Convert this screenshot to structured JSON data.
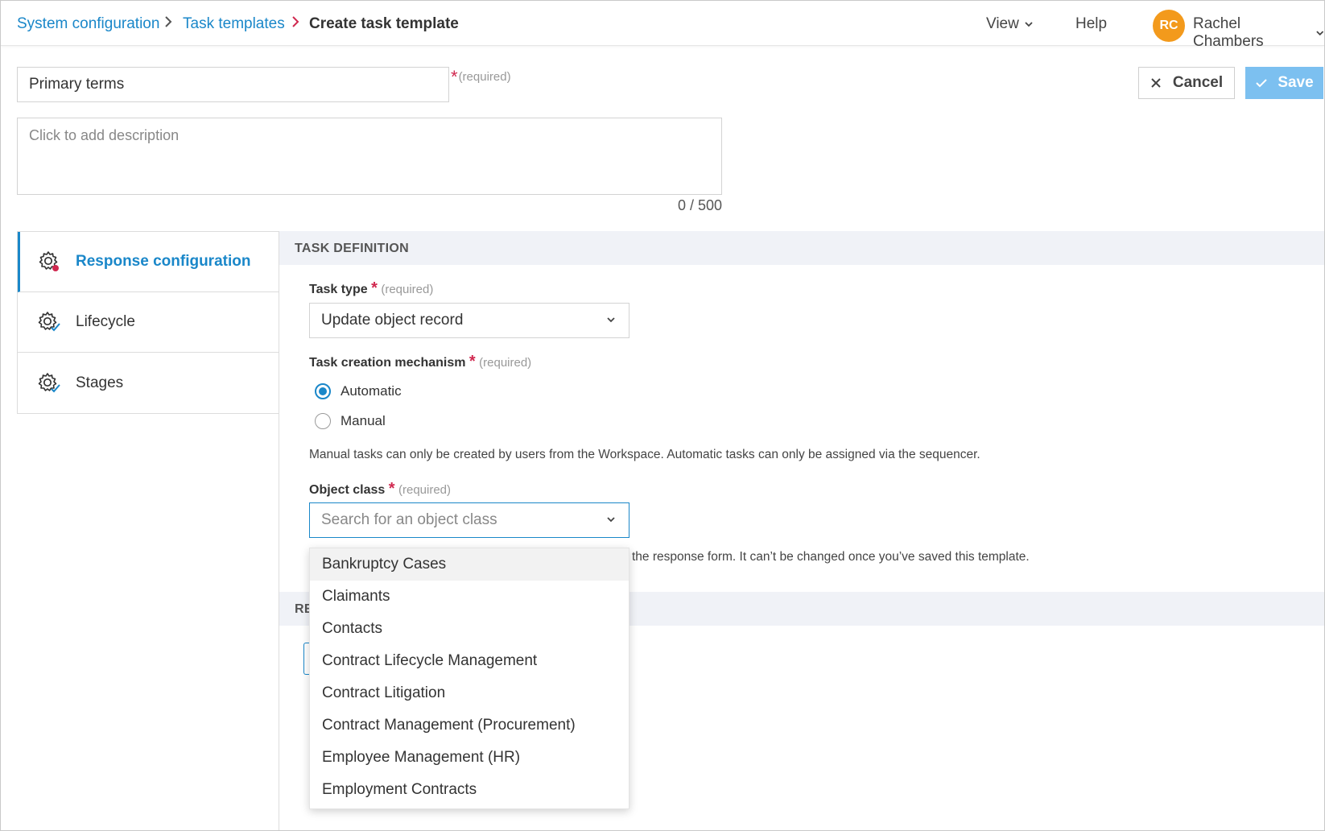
{
  "breadcrumb": {
    "items": [
      "System configuration",
      "Task templates"
    ],
    "current": "Create task template"
  },
  "header": {
    "view_label": "View",
    "help_label": "Help",
    "user_initials": "RC",
    "user_name": "Rachel Chambers",
    "avatar_color": "#f39a1c"
  },
  "template": {
    "name_value": "Primary terms",
    "name_required": "(required)",
    "description_placeholder": "Click to add description",
    "char_counter": "0 / 500"
  },
  "actions": {
    "cancel_label": "Cancel",
    "save_label": "Save"
  },
  "sidenav": {
    "items": [
      {
        "label": "Response configuration",
        "active": true
      },
      {
        "label": "Lifecycle"
      },
      {
        "label": "Stages"
      }
    ]
  },
  "task_definition": {
    "section_title": "TASK DEFINITION",
    "task_type_label": "Task type",
    "task_type_required": "(required)",
    "task_type_value": "Update object record",
    "mechanism_label": "Task creation mechanism",
    "mechanism_required": "(required)",
    "mechanism_options": [
      {
        "label": "Automatic",
        "checked": true
      },
      {
        "label": "Manual",
        "checked": false
      }
    ],
    "mechanism_help": "Manual tasks can only be created by users from the Workspace. Automatic tasks can only be assigned via the sequencer.",
    "object_class_label": "Object class",
    "object_class_required": "(required)",
    "object_class_placeholder": "Search for an object class",
    "object_class_help_partial": "the response form. It can’t be changed once you’ve saved this template.",
    "object_class_options": [
      "Bankruptcy Cases",
      "Claimants",
      "Contacts",
      "Contract Lifecycle Management",
      "Contract Litigation",
      "Contract Management (Procurement)",
      "Employee Management (HR)",
      "Employment Contracts"
    ]
  },
  "second_section": {
    "title_partial": "RE"
  },
  "colors": {
    "accent": "#1a87c9",
    "required_star": "#d0284f",
    "save_disabled": "#7cc0f0",
    "section_bg": "#f0f2f7"
  }
}
